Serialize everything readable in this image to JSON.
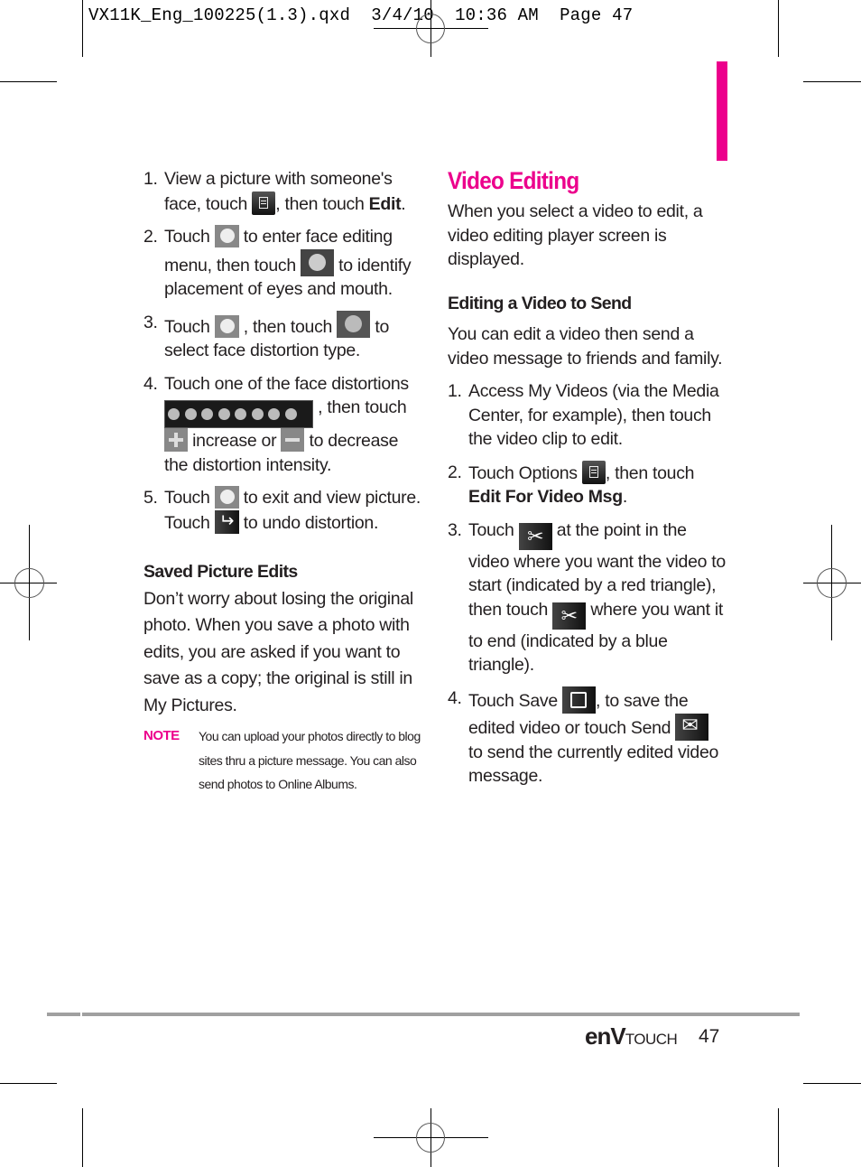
{
  "slug": "VX11K_Eng_100225(1.3).qxd  3/4/10  10:36 AM  Page 47",
  "accent_color": "#ec008c",
  "left_column": {
    "steps": [
      {
        "num": "1.",
        "parts": [
          "View a picture with someone's face, touch ",
          ", then touch ",
          "Edit",
          "."
        ]
      },
      {
        "num": "2.",
        "parts": [
          "Touch ",
          " to enter face editing menu, then touch ",
          " to identify placement of eyes and mouth."
        ]
      },
      {
        "num": "3.",
        "parts": [
          "Touch ",
          " , then touch ",
          " to select face distortion type."
        ]
      },
      {
        "num": "4.",
        "parts": [
          "Touch one of the face distortions ",
          " , then touch ",
          " increase or ",
          " to decrease the distortion intensity."
        ]
      },
      {
        "num": "5.",
        "parts": [
          "Touch ",
          " to exit and view picture. Touch ",
          " to undo distortion."
        ]
      }
    ],
    "saved_heading": "Saved Picture Edits",
    "saved_body": "Don’t worry about losing the original photo. When you save a photo with edits, you are asked if you want to save as a copy; the original is still in My Pictures.",
    "note_label": "NOTE",
    "note_text": "You can upload your photos directly to blog sites thru a picture message. You can also send photos to Online Albums."
  },
  "right_column": {
    "title": "Video Editing",
    "intro": "When you select a video to edit, a video editing player screen is displayed.",
    "sub_heading": "Editing a Video to Send",
    "sub_intro": "You can edit a video then send a video message to friends and family.",
    "steps": [
      {
        "num": "1.",
        "parts": [
          "Access My Videos (via the Media Center, for example), then touch the video clip to edit."
        ]
      },
      {
        "num": "2.",
        "parts": [
          "Touch Options ",
          ", then touch ",
          "Edit For Video Msg",
          "."
        ]
      },
      {
        "num": "3.",
        "parts": [
          "Touch ",
          " at the point in the video where you want the video to start (indicated by a red triangle), then touch ",
          " where you want it to end (indicated by a blue triangle)."
        ]
      },
      {
        "num": "4.",
        "parts": [
          "Touch Save ",
          ", to save the edited video or touch Send ",
          " to send the currently edited video message."
        ]
      }
    ]
  },
  "footer": {
    "brand_main": "enV",
    "brand_sub": "TOUCH",
    "page_number": "47"
  }
}
